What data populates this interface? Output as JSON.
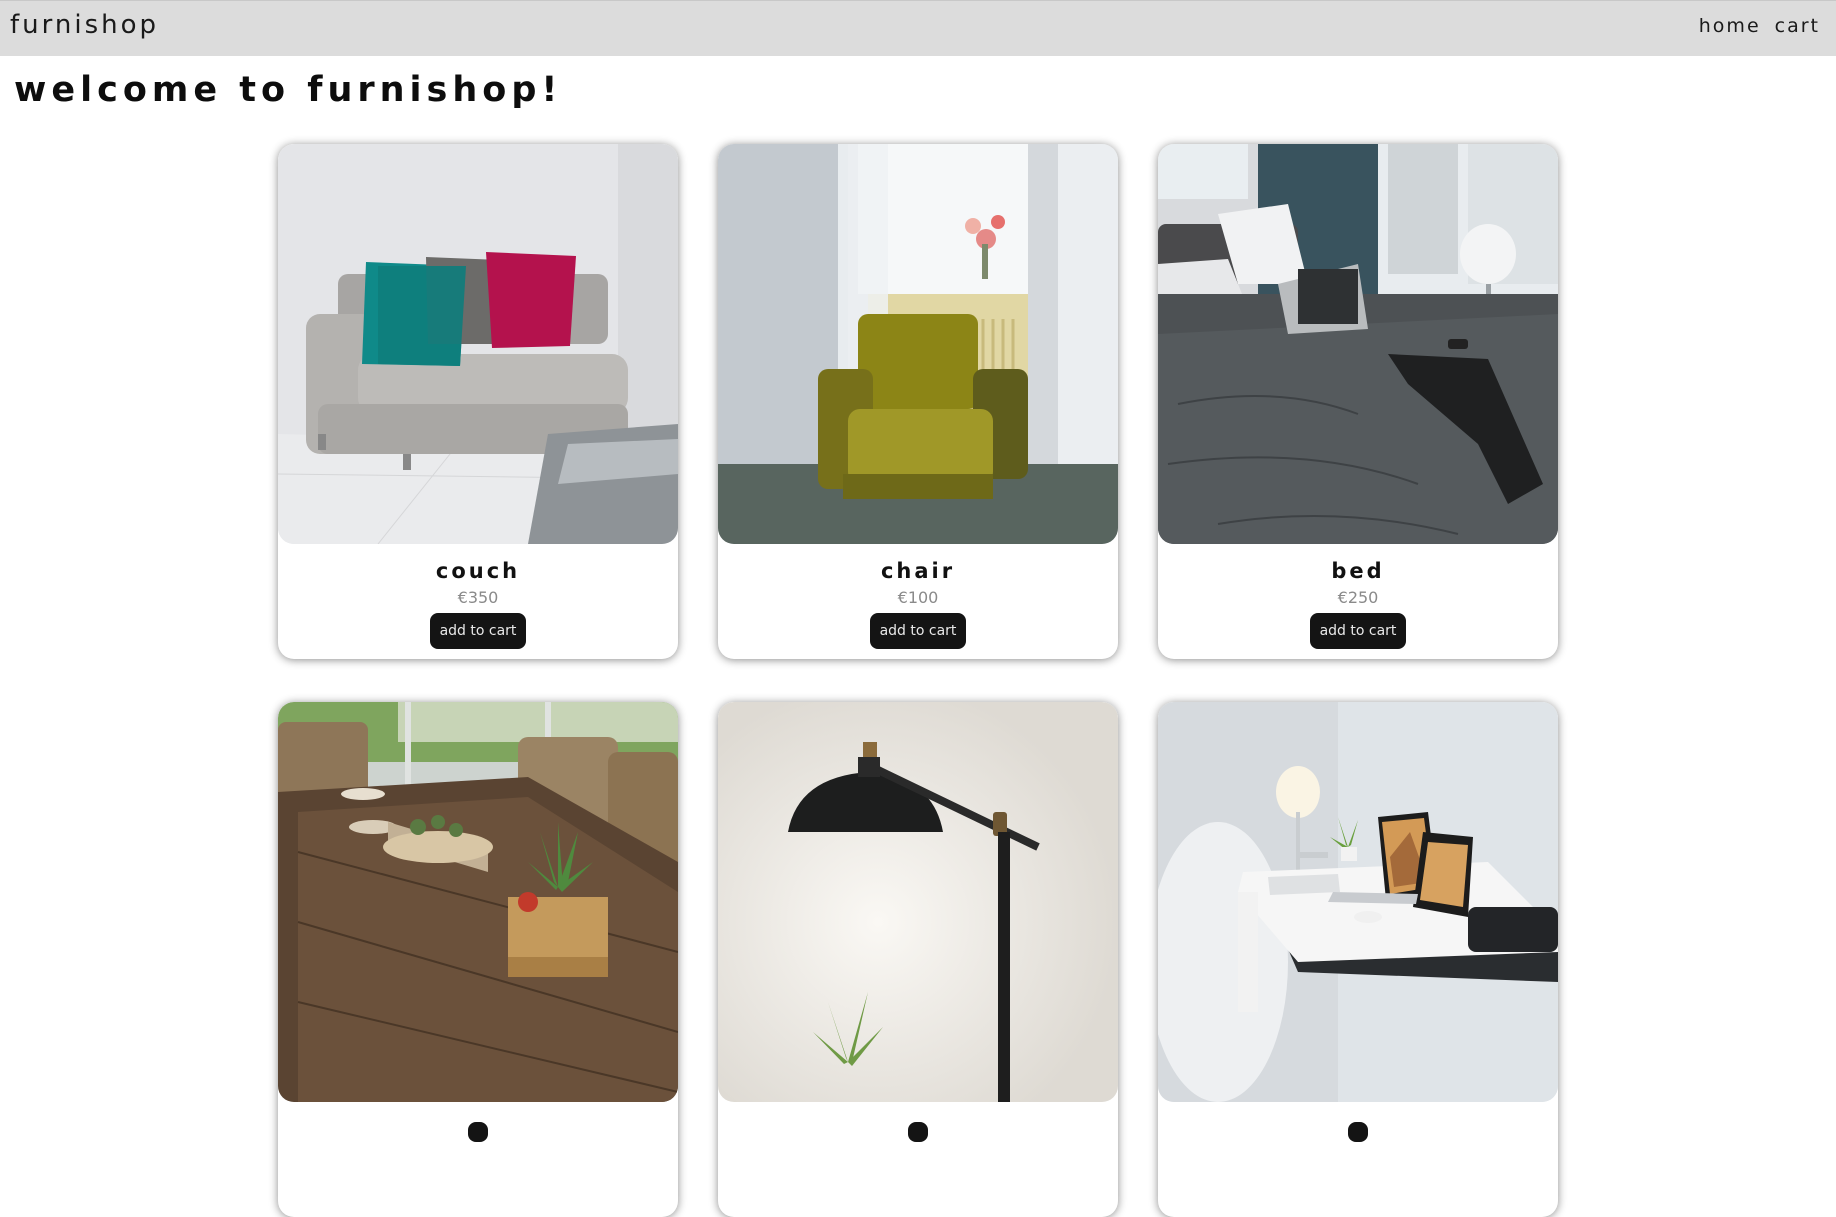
{
  "navbar": {
    "brand": "furnishop",
    "links": [
      "home",
      "cart"
    ]
  },
  "page": {
    "heading": "welcome to furnishop!"
  },
  "products": [
    {
      "name": "couch",
      "price": "€350",
      "button": "add to cart"
    },
    {
      "name": "chair",
      "price": "€100",
      "button": "add to cart"
    },
    {
      "name": "bed",
      "price": "€250",
      "button": "add to cart"
    },
    {
      "name": "",
      "price": "",
      "button": ""
    },
    {
      "name": "",
      "price": "",
      "button": ""
    },
    {
      "name": "",
      "price": "",
      "button": ""
    }
  ]
}
